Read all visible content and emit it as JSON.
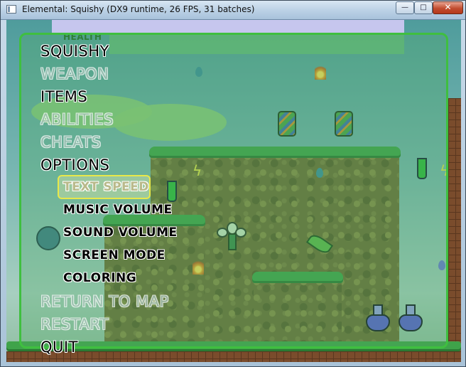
{
  "window": {
    "title": "Elemental: Squishy (DX9 runtime, 26 FPS, 31 batches)",
    "minimize_glyph": "—",
    "maximize_glyph": "□",
    "close_glyph": "✕"
  },
  "hud": {
    "health_label": "HEALTH"
  },
  "menu": {
    "main_items": [
      {
        "label": "SQUISHY",
        "state": "enabled"
      },
      {
        "label": "WEAPON",
        "state": "disabled"
      },
      {
        "label": "ITEMS",
        "state": "enabled"
      },
      {
        "label": "ABILITIES",
        "state": "disabled"
      },
      {
        "label": "CHEATS",
        "state": "disabled"
      },
      {
        "label": "OPTIONS",
        "state": "enabled"
      }
    ],
    "options_submenu": [
      {
        "label": "TEXT SPEED",
        "selected": true
      },
      {
        "label": "MUSIC VOLUME",
        "selected": false
      },
      {
        "label": "SOUND VOLUME",
        "selected": false
      },
      {
        "label": "SCREEN MODE",
        "selected": false
      },
      {
        "label": "COLORING",
        "selected": false
      }
    ],
    "bottom_items": [
      {
        "label": "RETURN TO MAP",
        "state": "disabled"
      },
      {
        "label": "RESTART",
        "state": "disabled"
      },
      {
        "label": "QUIT",
        "state": "enabled"
      }
    ]
  },
  "colors": {
    "panel_border": "#3fbf3f",
    "selection_border": "#e8e84a",
    "close_button": "#c24d30"
  },
  "icons": [
    "app-icon",
    "minimize-icon",
    "maximize-icon",
    "close-icon",
    "potion-icon",
    "barrel-icon",
    "flask-icon",
    "flame-icon",
    "lightning-icon",
    "leaf-icon",
    "water-drop-icon"
  ]
}
